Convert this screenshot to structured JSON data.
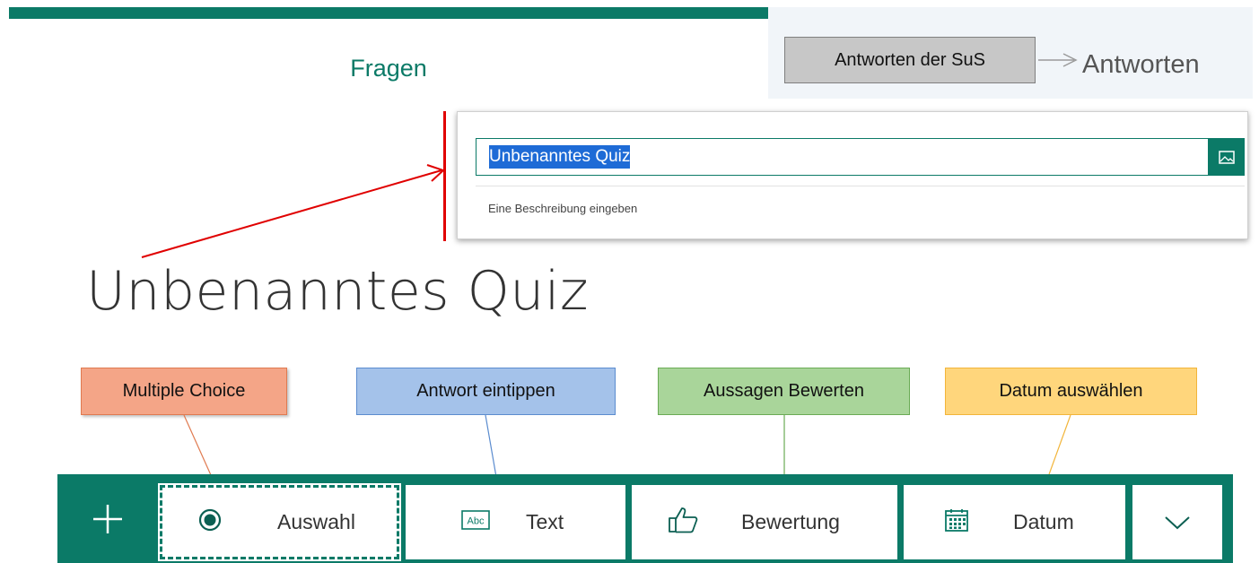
{
  "tabs": {
    "questions_label": "Fragen",
    "responses_label": "Antworten"
  },
  "annotations": {
    "responses_callout": "Antworten der SuS",
    "multiple_choice": "Multiple Choice",
    "type_answer": "Antwort eintippen",
    "rate_statements": "Aussagen Bewerten",
    "choose_date": "Datum auswählen"
  },
  "title_card": {
    "title_value": "Unbenanntes Quiz",
    "description_placeholder": "Eine Beschreibung eingeben",
    "image_icon": "image-icon"
  },
  "page_title": "Unbenanntes Quiz",
  "toolbar": {
    "add_icon": "plus-icon",
    "items": [
      {
        "label": "Auswahl",
        "icon": "radio-icon"
      },
      {
        "label": "Text",
        "icon": "abc-icon"
      },
      {
        "label": "Bewertung",
        "icon": "thumbs-up-icon"
      },
      {
        "label": "Datum",
        "icon": "calendar-icon"
      }
    ],
    "more_icon": "chevron-down-icon"
  },
  "colors": {
    "accent": "#0b7a67",
    "selection": "#1e6bd6",
    "annotation_arrow": "#e00000"
  }
}
